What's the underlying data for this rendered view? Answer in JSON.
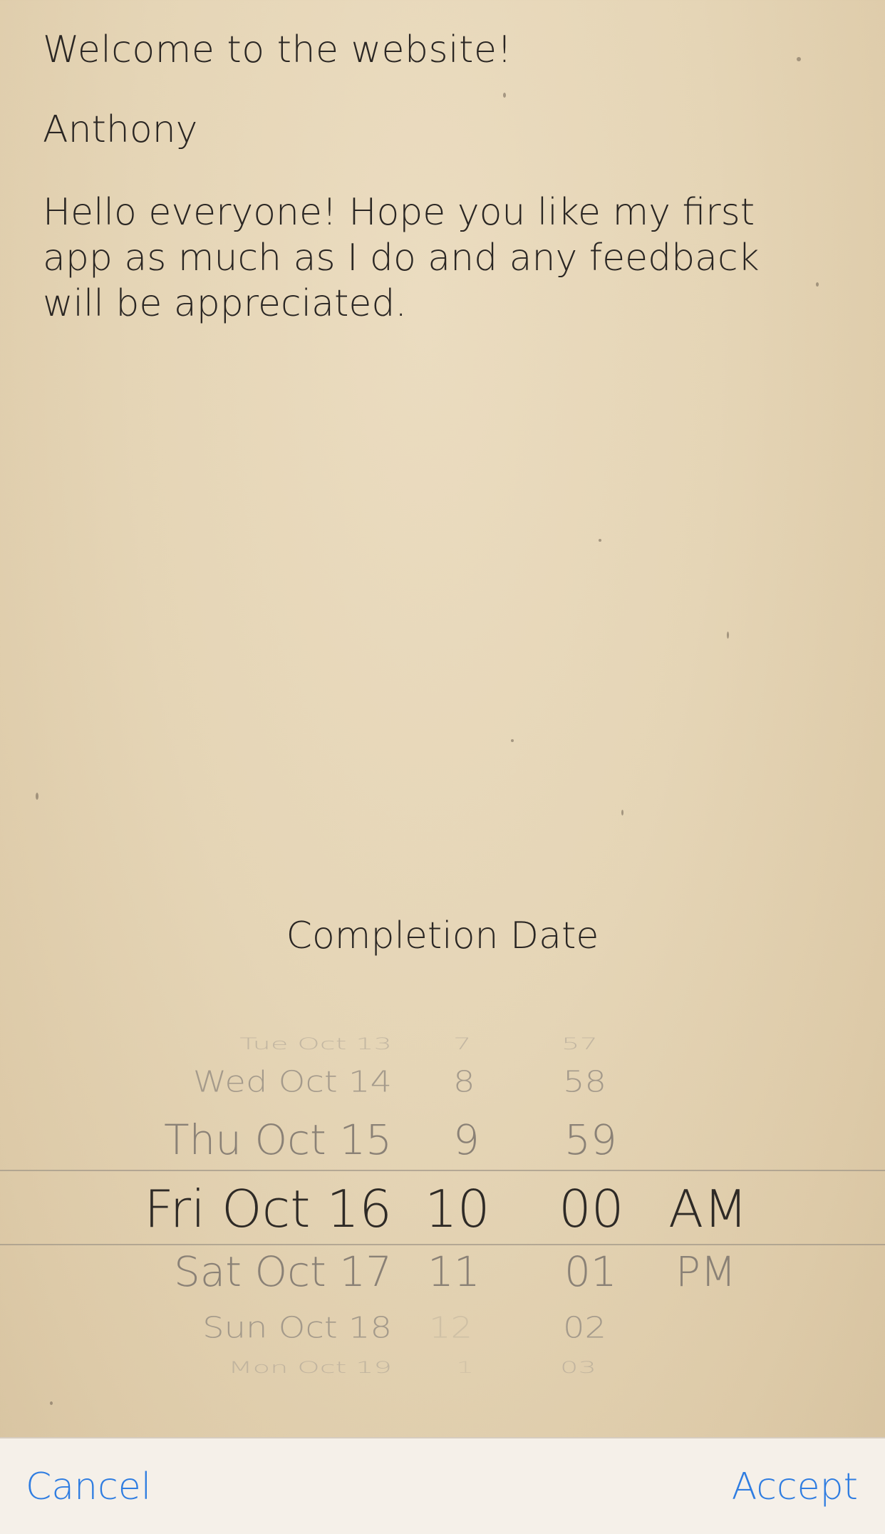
{
  "note": {
    "title": "Welcome to the website!",
    "author": "Anthony",
    "body": "Hello everyone! Hope you like my first app as much as I do and any feedback will be appreciated."
  },
  "picker": {
    "title": "Completion Date",
    "dates": [
      "Tue Oct 13",
      "Wed Oct 14",
      "Thu Oct 15",
      "Fri Oct 16",
      "Sat Oct 17",
      "Sun Oct 18",
      "Mon Oct 19"
    ],
    "hours": [
      "7",
      "8",
      "9",
      "10",
      "11",
      "12",
      "1"
    ],
    "minutes": [
      "57",
      "58",
      "59",
      "00",
      "01",
      "02",
      "03"
    ],
    "ampm": [
      "AM",
      "PM"
    ],
    "selected": {
      "date": "Fri Oct 16",
      "hour": "10",
      "minute": "00",
      "ampm": "AM"
    }
  },
  "actions": {
    "cancel": "Cancel",
    "accept": "Accept"
  },
  "colors": {
    "accent": "#2f7de1",
    "paper": "#e5d5b6",
    "text": "#2a2623"
  }
}
